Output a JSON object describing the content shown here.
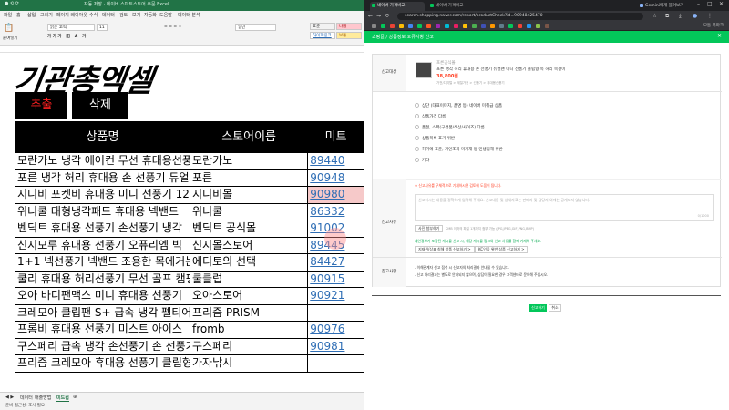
{
  "excel": {
    "title_bar": "자동 저장 · 네이버 스마트스토어 주문 Excel",
    "ribbon_tabs": [
      "파일",
      "홈",
      "삽입",
      "그리기",
      "페이지 레이아웃",
      "수식",
      "데이터",
      "검토",
      "보기",
      "자동화",
      "도움말",
      "데이터 분석"
    ],
    "ribbon": {
      "paste_label": "붙여넣기",
      "font_name": "맑은 고딕",
      "font_size": "11",
      "number_format": "일반",
      "style_normal": "표준",
      "style_bad": "나쁨",
      "style_hyperlink": "하이퍼링크",
      "style_good": "보통"
    },
    "logo_text": "기관총엑셀",
    "buttons": {
      "order": "추출",
      "delete": "삭제"
    },
    "table": {
      "headers": [
        "상품명",
        "스토어이름",
        "미트"
      ],
      "rows": [
        [
          "모란카노 냉각 에어컨 무선 휴대용선풍기",
          "모란카노",
          "89440"
        ],
        [
          "포른 냉각 허리 휴대용 손 선풍기 듀얼",
          "포른",
          "90948"
        ],
        [
          "지니비 포켓비 휴대용 미니 선풍기 120단",
          "지니비몰",
          "90980"
        ],
        [
          "위니쿨 대형냉각패드 휴대용 넥밴드",
          "위니쿨",
          "86332"
        ],
        [
          "벤딕트 휴대용 선풍기 손선풍기 냉각",
          "벤딕트 공식몰",
          "91002"
        ],
        [
          "신지모루 휴대용 선풍기 오퓨리엠 빅",
          "신지몰스토어",
          "89445"
        ],
        [
          "1+1 넥선풍기 넥밴드 조용한 목에거는",
          "에디토의 선택",
          "84427"
        ],
        [
          "쿨리 휴대용 허리선풍기 무선 골프 캠핑",
          "쿨클럽",
          "90915"
        ],
        [
          "오아 바디팬맥스 미니 휴대용 선풍기",
          "오아스토어",
          "90921"
        ],
        [
          "크레모아 클립팬 S+ 급속 냉각 펠티어",
          "프리즘 PRISM",
          ""
        ],
        [
          "프롬비 휴대용 선풍기 미스트 아이스",
          "fromb",
          "90976"
        ],
        [
          "구스페리 급속 냉각 손선풍기 손 선풍기",
          "구스페리",
          "90981"
        ],
        [
          "프리즘 크레모아 휴대용 선풍기 클립형",
          "가자낚시",
          ""
        ]
      ]
    },
    "sheet_tabs": [
      "데이터",
      "매출방법",
      "미드컵"
    ],
    "active_sheet": "미드컵",
    "status": "준비  접근성: 조사 필요"
  },
  "chrome": {
    "tabs": [
      "네이버 가격비교",
      "네이버 가격비교",
      "Gemini에게 물어보기"
    ],
    "url": "search.shopping.naver.com/report/productCheck?id=90948425470",
    "all_bookmarks": "모든 북마크",
    "page": {
      "header_title": "쇼핑몰 / 상품정보 오류사항 신고",
      "close_label": "✕",
      "label_target": "신고대상",
      "product_store": "포른공식몰",
      "product_name": "포른 냉각 허리 휴대용 손 선풍기 듀얼팬 미니 선풍기 클립형 목 허리 목걸이",
      "product_price": "38,800원",
      "product_category": "가전/디지털 > 계절가전 > 선풍기 > 휴대용선풍기",
      "label_type": "신고유형",
      "options": [
        "상단 (대표이미지, 품명 등) 네이버 미취급 상품",
        "상품가격 다름",
        "품절, 스펙(구성품/색상/사이즈) 다름",
        "상품목록 표기 위반",
        "허가에 표준, 개인조회 미게재 등 민생침해 위반",
        "기타"
      ],
      "label_reason": "신고사유",
      "reason_warning": "※ 신고사유를 구체적으로 기재하시면 검토에 도움이 됩니다.",
      "reason_placeholder": "신고하시는 내용을 정확하게 입력해 주세요. 신고내용 및 상세자료는 판매자 및 담당자 외에는 공개되지 않습니다.",
      "reason_count": "0/1000",
      "attach_button": "사진 첨부하기",
      "attach_note": "2MB 이하의 파일 1개까지 첨부 가능 (JPG,JPEG,GIF,PNG,BMP)",
      "privacy_note": "개인정보가 포함된 게시물 신고 시, 해당 게시물 링크와 신고 사유를 함께 기재해 주세요.",
      "link_button1": "지재권/상표 침해 상품 신고하기 >",
      "link_button2": "KC인증 위반 상품 신고하기 >",
      "label_notice": "참고사항",
      "notice1": "- 이해관계자 신고 접수 시 신고자의 처리결과 안내될 수 있습니다.",
      "notice2": "- 신고 처리결과는 별도로 안내되지 않으며, 상담이 필요한 경우 고객센터로 문의해 주십시오.",
      "submit": "신고하기",
      "cancel": "취소"
    }
  }
}
